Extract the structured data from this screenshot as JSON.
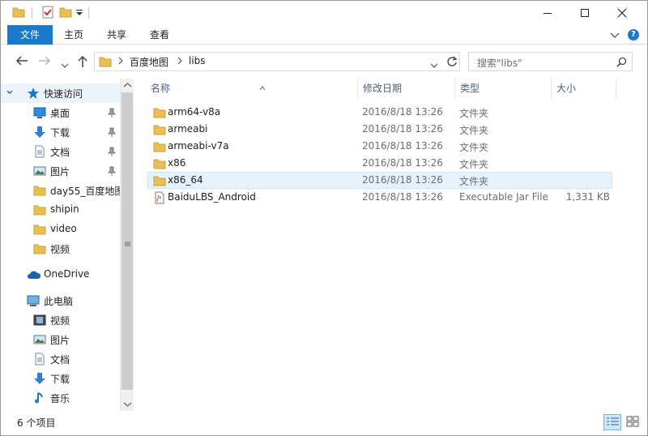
{
  "ribbon": {
    "tabs": [
      "文件",
      "主页",
      "共享",
      "查看"
    ],
    "help": "?"
  },
  "address": {
    "crumbs": [
      "百度地图",
      "libs"
    ]
  },
  "search": {
    "placeholder": "搜索\"libs\""
  },
  "sidebar": {
    "items": [
      {
        "label": "快速访问",
        "icon": "star-icon"
      },
      {
        "label": "桌面",
        "icon": "desktop-icon",
        "pinned": true
      },
      {
        "label": "下载",
        "icon": "download-arrow-icon",
        "pinned": true
      },
      {
        "label": "文档",
        "icon": "document-icon",
        "pinned": true
      },
      {
        "label": "图片",
        "icon": "picture-icon",
        "pinned": true
      },
      {
        "label": "day55_百度地图",
        "icon": "folder-icon"
      },
      {
        "label": "shipin",
        "icon": "folder-icon"
      },
      {
        "label": "video",
        "icon": "folder-icon"
      },
      {
        "label": "视频",
        "icon": "folder-icon"
      },
      {
        "label": "OneDrive",
        "icon": "cloud-icon"
      },
      {
        "label": "此电脑",
        "icon": "computer-icon"
      },
      {
        "label": "视频",
        "icon": "video-icon"
      },
      {
        "label": "图片",
        "icon": "picture-icon"
      },
      {
        "label": "文档",
        "icon": "document-icon"
      },
      {
        "label": "下载",
        "icon": "download-arrow-icon"
      },
      {
        "label": "音乐",
        "icon": "music-note-icon"
      }
    ]
  },
  "columns": {
    "name": "名称",
    "date": "修改日期",
    "type": "类型",
    "size": "大小"
  },
  "files": [
    {
      "name": "arm64-v8a",
      "date": "2016/8/18 13:26",
      "type": "文件夹",
      "size": "",
      "icon": "folder-icon"
    },
    {
      "name": "armeabi",
      "date": "2016/8/18 13:26",
      "type": "文件夹",
      "size": "",
      "icon": "folder-icon"
    },
    {
      "name": "armeabi-v7a",
      "date": "2016/8/18 13:26",
      "type": "文件夹",
      "size": "",
      "icon": "folder-icon"
    },
    {
      "name": "x86",
      "date": "2016/8/18 13:26",
      "type": "文件夹",
      "size": "",
      "icon": "folder-icon"
    },
    {
      "name": "x86_64",
      "date": "2016/8/18 13:26",
      "type": "文件夹",
      "size": "",
      "icon": "folder-icon",
      "hovered": true
    },
    {
      "name": "BaiduLBS_Android",
      "date": "2016/8/18 13:26",
      "type": "Executable Jar File",
      "size": "1,331 KB",
      "icon": "jar-file-icon"
    }
  ],
  "status": {
    "item_count": "6 个项目"
  },
  "colors": {
    "accent": "#1979ca",
    "folder": "#e8c056",
    "hover_row": "#e5f3ff"
  }
}
